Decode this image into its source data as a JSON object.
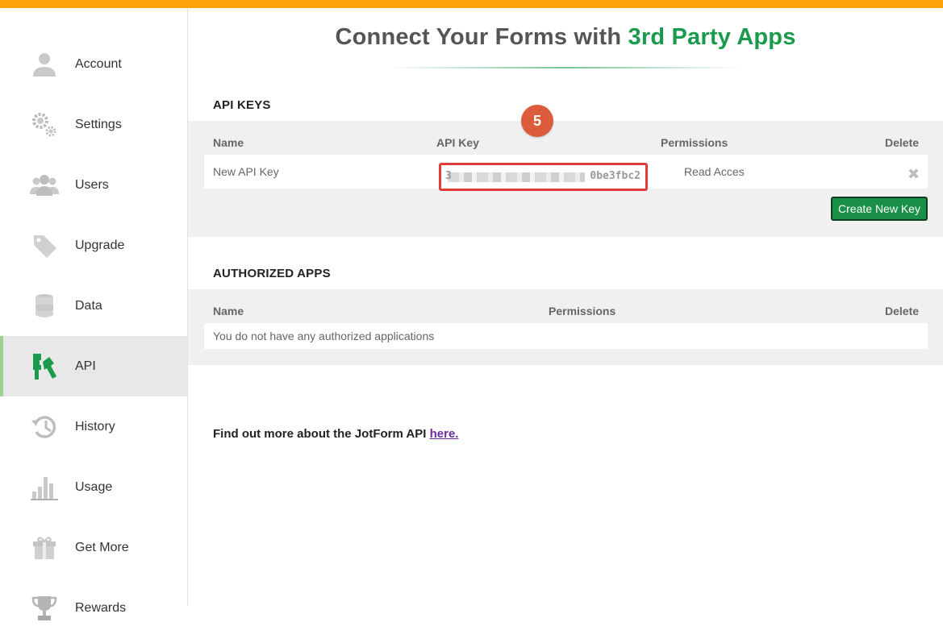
{
  "title": {
    "prefix": "Connect Your Forms with",
    "accent": "3rd Party Apps"
  },
  "sidebar": {
    "items": [
      {
        "label": "Account",
        "icon": "user-icon"
      },
      {
        "label": "Settings",
        "icon": "gear-icon"
      },
      {
        "label": "Users",
        "icon": "users-icon"
      },
      {
        "label": "Upgrade",
        "icon": "tag-icon"
      },
      {
        "label": "Data",
        "icon": "database-icon"
      },
      {
        "label": "API",
        "icon": "api-key-icon",
        "active": true
      },
      {
        "label": "History",
        "icon": "history-icon"
      },
      {
        "label": "Usage",
        "icon": "bar-chart-icon"
      },
      {
        "label": "Get More",
        "icon": "gift-icon"
      },
      {
        "label": "Rewards",
        "icon": "trophy-icon"
      }
    ]
  },
  "api_keys": {
    "heading": "API KEYS",
    "columns": {
      "name": "Name",
      "key": "API Key",
      "permissions": "Permissions",
      "delete": "Delete"
    },
    "rows": [
      {
        "name": "New API Key",
        "key_prefix": "3",
        "key_suffix": "0be3fbc2",
        "permissions": "Read Acces"
      }
    ],
    "create_button": "Create New Key"
  },
  "authorized_apps": {
    "heading": "AUTHORIZED APPS",
    "columns": {
      "name": "Name",
      "permissions": "Permissions",
      "delete": "Delete"
    },
    "empty_message": "You do not have any authorized applications"
  },
  "step_badge": "5",
  "footer": {
    "text": "Find out more about the JotForm API",
    "link": "here."
  },
  "colors": {
    "top_bar": "#ffa50a",
    "accent_green": "#1a9a4d",
    "highlight_red": "#e23b3b",
    "badge": "#dc5b3b"
  }
}
